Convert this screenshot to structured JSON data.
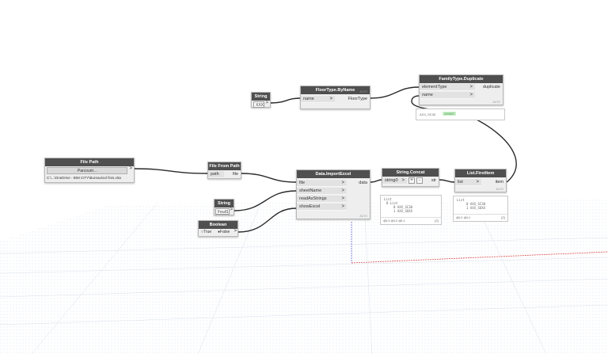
{
  "nodes": {
    "file_path": {
      "title": "File Path",
      "button": "Parcourir...",
      "path": "C:\\...\\OneDrive - BIM CITY\\Bureau\\sol finis.xlsx"
    },
    "file_from_path": {
      "title": "File From Path",
      "in_path": "path",
      "out_file": "file"
    },
    "string1": {
      "title": "String",
      "value": "XXX",
      "arrow": ">"
    },
    "floortype": {
      "title": "FloorType.ByName",
      "in_name": "name",
      "out": "FloorType",
      "foot": "AUTO"
    },
    "family_dup": {
      "title": "FamilyType.Duplicate",
      "in1": "elementType",
      "in2": "name",
      "out": "duplicate",
      "foot": "AUTO",
      "preview_label": "AXX_SC30",
      "preview_value": "220937"
    },
    "string2": {
      "title": "String",
      "value": "Feuil1",
      "arrow": ">"
    },
    "boolean": {
      "title": "Boolean",
      "opt_true": "True",
      "opt_false": "False"
    },
    "import_excel": {
      "title": "Data.ImportExcel",
      "in1": "file",
      "in2": "sheetName",
      "in3": "readAsStrings",
      "in4": "showExcel",
      "out": "data",
      "foot": "AUTO"
    },
    "concat": {
      "title": "String.Concat",
      "in": "string0",
      "plus": "+",
      "minus": "-",
      "out": "str",
      "preview": {
        "l1": "List",
        "l2": "0 List",
        "l3": "0 AXX_SC30",
        "l4": "1 AXX_SOXX",
        "levels": "@L3 @L2 @L1",
        "count": "{2}"
      }
    },
    "first_item": {
      "title": "List.FirstItem",
      "in": "list",
      "out": "item",
      "foot": "AUTO",
      "preview": {
        "l1": "List",
        "l2": "0 AXX_SC30",
        "l3": "1 AXX_SOXX",
        "levels": "@L2 @L1",
        "count": "{2}"
      }
    }
  }
}
